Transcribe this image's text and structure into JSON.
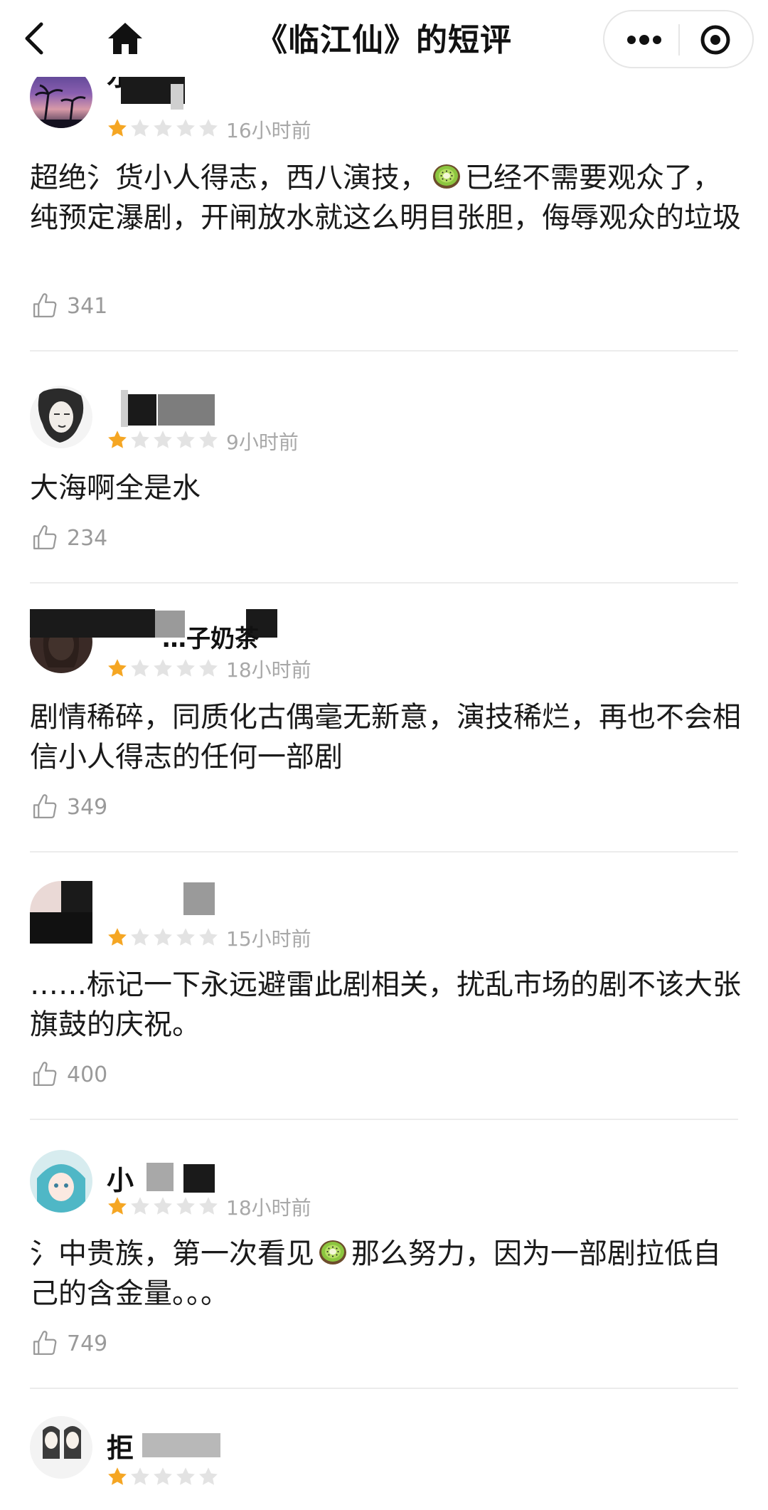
{
  "header": {
    "title": "《临江仙》的短评",
    "back_icon": "chevron-left-icon",
    "home_icon": "home-icon",
    "more_icon": "more-dots-icon",
    "target_icon": "target-icon"
  },
  "reviews": [
    {
      "username": "水",
      "rating": 1,
      "max_rating": 5,
      "time": "16小时前",
      "text_before": "超绝氵货小人得志，西八演技，",
      "emoji": "kiwi-emoji",
      "text_after": "已经不需要观众了，纯预定瀑剧，开闸放水就这么明目张胆，侮辱观众的垃圾",
      "likes": "341"
    },
    {
      "username": "",
      "rating": 1,
      "max_rating": 5,
      "time": "9小时前",
      "text": "大海啊全是水",
      "likes": "234"
    },
    {
      "username": "…子奶茶",
      "rating": 1,
      "max_rating": 5,
      "time": "18小时前",
      "text": "剧情稀碎，同质化古偶毫无新意，演技稀烂，再也不会相信小人得志的任何一部剧",
      "likes": "349"
    },
    {
      "username": "",
      "rating": 1,
      "max_rating": 5,
      "time": "15小时前",
      "text": "……标记一下永远避雷此剧相关，扰乱市场的剧不该大张旗鼓的庆祝。",
      "likes": "400"
    },
    {
      "username": "小",
      "rating": 1,
      "max_rating": 5,
      "time": "18小时前",
      "text_before": "氵中贵族，第一次看见",
      "emoji": "kiwi-emoji",
      "text_after": "那么努力，因为一部剧拉低自己的含金量。。。",
      "likes": "749"
    },
    {
      "username": "拒",
      "rating": 1,
      "max_rating": 5,
      "time": "",
      "text": "",
      "likes": ""
    }
  ],
  "colors": {
    "star_filled": "#f5a623",
    "star_empty": "#e3e3e3",
    "meta_text": "#a8a8a8",
    "divider": "#ececec"
  }
}
